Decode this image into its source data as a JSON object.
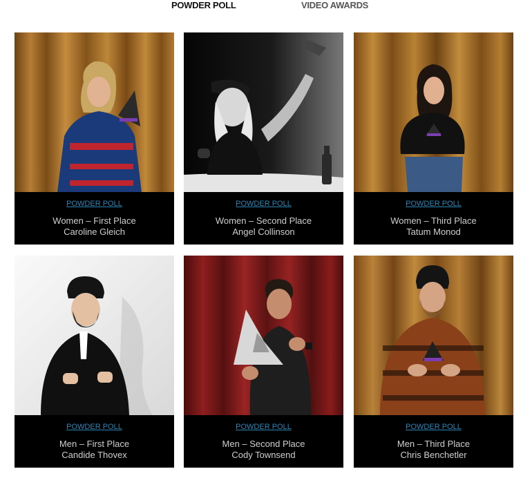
{
  "tabs": {
    "powder_poll": "POWDER POLL",
    "video_awards": "VIDEO AWARDS"
  },
  "colors": {
    "link": "#2c86b8",
    "caption_bg": "#000000",
    "caption_text": "#cfcfcf"
  },
  "cards": [
    {
      "category": "POWDER POLL",
      "place": "Women – First Place",
      "name": "Caroline Gleich",
      "photo_icon": "winner-photo"
    },
    {
      "category": "POWDER POLL",
      "place": "Women – Second Place",
      "name": "Angel Collinson",
      "photo_icon": "winner-photo"
    },
    {
      "category": "POWDER POLL",
      "place": "Women – Third Place",
      "name": "Tatum Monod",
      "photo_icon": "winner-photo"
    },
    {
      "category": "POWDER POLL",
      "place": "Men – First Place",
      "name": "Candide Thovex",
      "photo_icon": "winner-photo"
    },
    {
      "category": "POWDER POLL",
      "place": "Men – Second Place",
      "name": "Cody Townsend",
      "photo_icon": "winner-photo"
    },
    {
      "category": "POWDER POLL",
      "place": "Men – Third Place",
      "name": "Chris Benchetler",
      "photo_icon": "winner-photo"
    }
  ]
}
